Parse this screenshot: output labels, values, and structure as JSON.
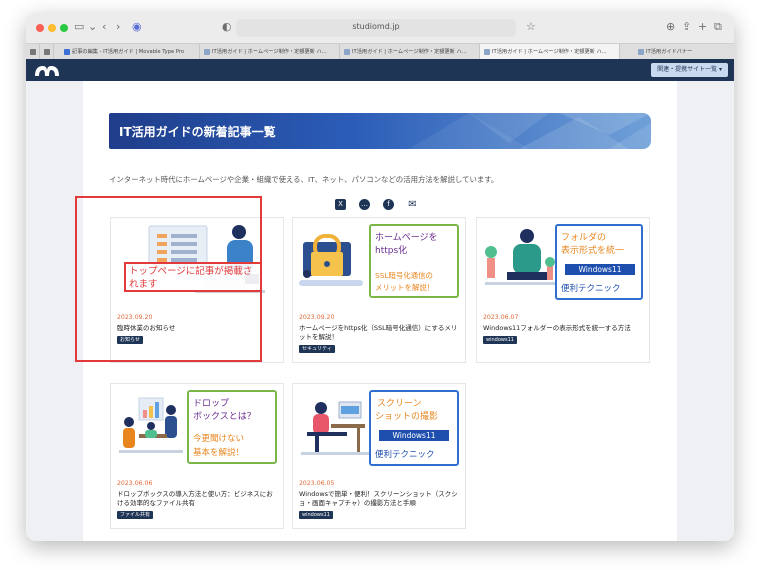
{
  "browser": {
    "url": "studiomd.jp",
    "tabs": [
      "記事の編集 - IT活用ガイド | Movable Type Pro",
      "IT活用ガイド | ホームページ制作・定額更新 ハ...",
      "IT活用ガイド | ホームページ制作・定額更新 ハ...",
      "IT活用ガイド | ホームページ制作・定額更新 ハ...",
      "IT活用ガイドバナー"
    ]
  },
  "site": {
    "nav_button": "関連・提携サイト一覧 ▾"
  },
  "main": {
    "heading": "IT活用ガイドの新着記事一覧",
    "intro": "インターネット時代にホームページや企業・組織で使える、IT、ネット、パソコンなどの活用方法を解説しています。"
  },
  "social": [
    {
      "icon": "x-icon",
      "glyph": "X"
    },
    {
      "icon": "line-icon",
      "glyph": "…"
    },
    {
      "icon": "facebook-icon",
      "glyph": "f"
    },
    {
      "icon": "mail-icon",
      "glyph": "✉"
    }
  ],
  "articles": [
    {
      "date": "2023.09.20",
      "title": "臨時休業のお知らせ",
      "tag": "お知らせ"
    },
    {
      "date": "2023.09.20",
      "title": "ホームページをhttps化（SSL暗号化通信）にするメリットを解説！",
      "tag": "セキュリティ",
      "thumb": {
        "line1": "ホームページを",
        "line2": "https化",
        "line3": "SSL暗号化通信の",
        "line4": "メリットを解説！"
      }
    },
    {
      "date": "2023.06.07",
      "title": "Windows11フォルダーの表示形式を統一する方法",
      "tag": "windows11",
      "thumb": {
        "line1": "フォルダの",
        "line2": "表示形式を統一",
        "line3": "Windows11",
        "line4": "便利テクニック"
      }
    },
    {
      "date": "2023.06.06",
      "title": "ドロップボックスの導入方法と使い方：ビジネスにおける効率的なファイル共有",
      "tag": "ファイル共有",
      "thumb": {
        "line1": "ドロップ",
        "line2": "ボックスとは？",
        "line3": "今更聞けない",
        "line4": "基本を解説！"
      }
    },
    {
      "date": "2023.06.05",
      "title": "Windowsで簡単・便利！スクリーンショット（スクショ・画面キャプチャ）の撮影方法と手順",
      "tag": "windows11",
      "thumb": {
        "line1": "スクリーン",
        "line2": "ショットの撮影",
        "line3": "Windows11",
        "line4": "便利テクニック"
      }
    }
  ],
  "annotation": {
    "text": "トップページに記事が掲載されます"
  }
}
